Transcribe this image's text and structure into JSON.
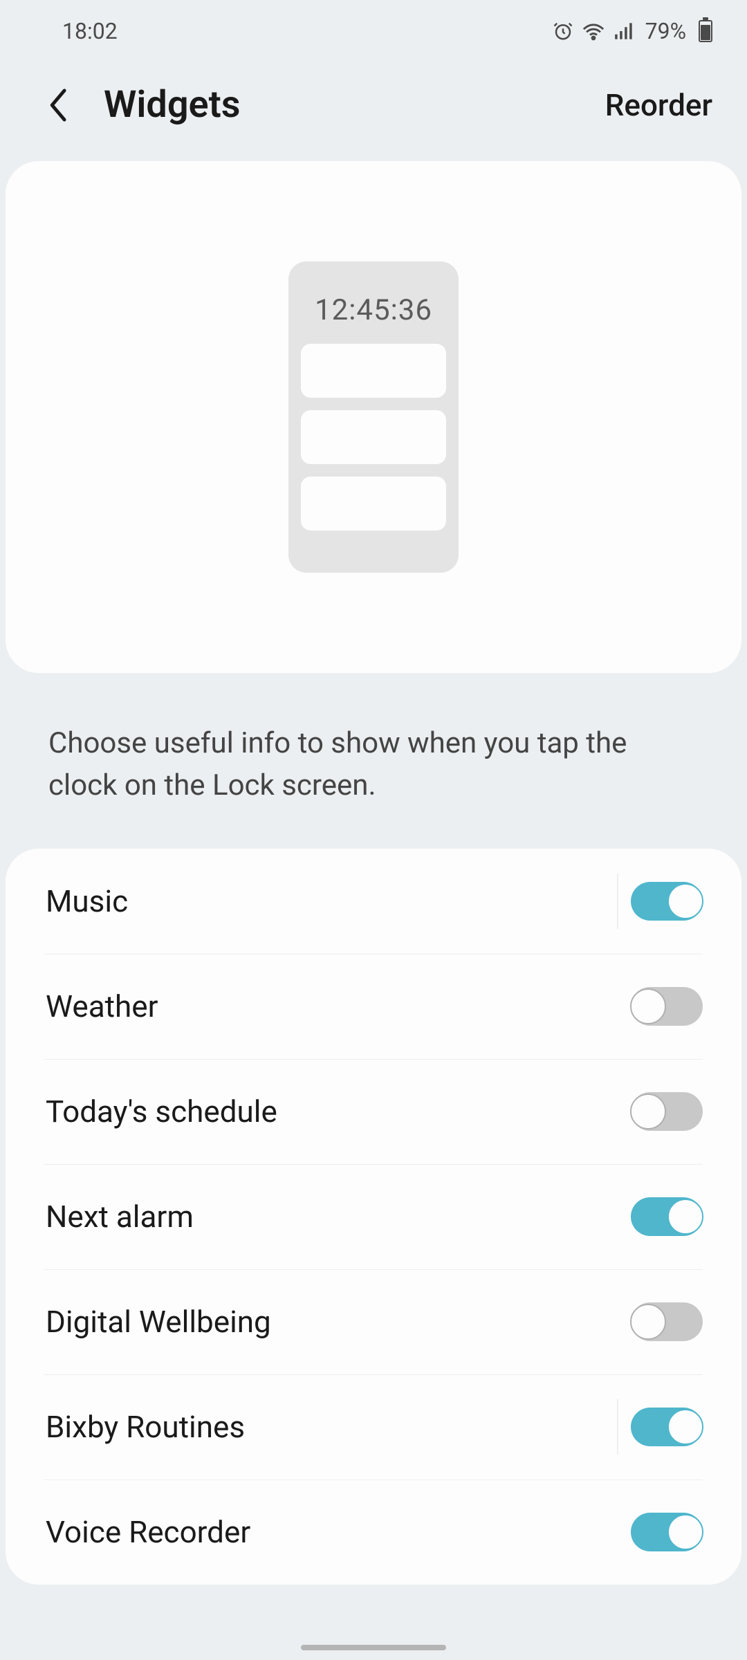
{
  "status": {
    "time": "18:02",
    "battery_pct": "79%"
  },
  "header": {
    "title": "Widgets",
    "reorder": "Reorder"
  },
  "preview": {
    "clock_sample": "12:45:36"
  },
  "description": "Choose useful info to show when you tap the clock on the Lock screen.",
  "widgets": [
    {
      "label": "Music",
      "on": true,
      "separator": true
    },
    {
      "label": "Weather",
      "on": false,
      "separator": false
    },
    {
      "label": "Today's schedule",
      "on": false,
      "separator": false
    },
    {
      "label": "Next alarm",
      "on": true,
      "separator": false
    },
    {
      "label": "Digital Wellbeing",
      "on": false,
      "separator": false
    },
    {
      "label": "Bixby Routines",
      "on": true,
      "separator": true
    },
    {
      "label": "Voice Recorder",
      "on": true,
      "separator": false
    }
  ]
}
